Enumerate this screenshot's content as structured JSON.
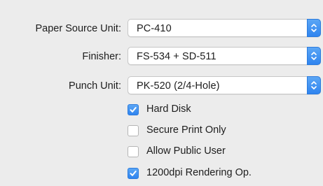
{
  "options": {
    "paper_source": {
      "label": "Paper Source Unit:",
      "value": "PC-410"
    },
    "finisher": {
      "label": "Finisher:",
      "value": "FS-534 + SD-511"
    },
    "punch_unit": {
      "label": "Punch Unit:",
      "value": "PK-520 (2/4-Hole)"
    },
    "checkboxes": [
      {
        "label": "Hard Disk",
        "checked": true
      },
      {
        "label": "Secure Print Only",
        "checked": false
      },
      {
        "label": "Allow Public User",
        "checked": false
      },
      {
        "label": "1200dpi Rendering Op.",
        "checked": true
      }
    ]
  },
  "colors": {
    "accent": "#3a8ff1",
    "background": "#ececec"
  },
  "icons": {
    "popup_arrows": "up-down-chevron-icon",
    "checkmark": "checkmark-icon"
  }
}
